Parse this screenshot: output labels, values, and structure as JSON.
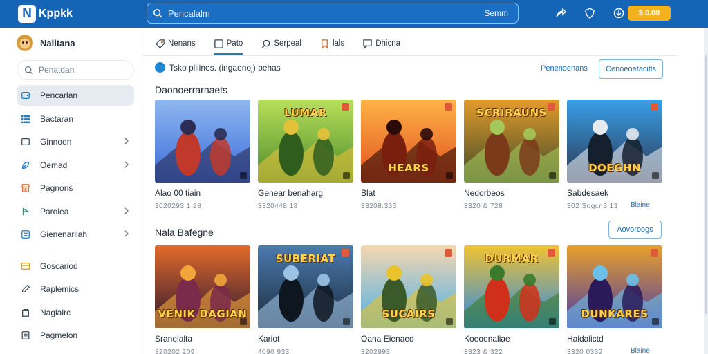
{
  "app": {
    "logo_letter": "N",
    "logo_text": "Kppkk"
  },
  "topbar": {
    "search_placeholder": "Pencalalm",
    "search_button": "Semm",
    "icons": [
      "share-icon",
      "shield-icon",
      "download-icon"
    ],
    "coins_label": "$ 0.00"
  },
  "sidebar": {
    "profile_name": "Nalltana",
    "search_placeholder": "Penatdan",
    "items": [
      {
        "label": "Pencarlan",
        "icon": "wallet-icon",
        "active": true,
        "chevron": false
      },
      {
        "label": "Bactaran",
        "icon": "list-icon",
        "active": false,
        "chevron": false
      },
      {
        "label": "Ginnoen",
        "icon": "square-icon",
        "active": false,
        "chevron": true
      },
      {
        "label": "Oemad",
        "icon": "leaf-icon",
        "active": false,
        "chevron": true
      },
      {
        "label": "Pagnons",
        "icon": "store-icon",
        "active": false,
        "chevron": false
      },
      {
        "label": "Parolea",
        "icon": "pin-icon",
        "active": false,
        "chevron": true
      },
      {
        "label": "Gienenarllah",
        "icon": "grid-icon",
        "active": false,
        "chevron": true
      },
      {
        "label": "Goscariod",
        "icon": "card-icon",
        "active": false,
        "chevron": false
      },
      {
        "label": "Raplemics",
        "icon": "pen-icon",
        "active": false,
        "chevron": false
      },
      {
        "label": "Naglalrc",
        "icon": "bag-icon",
        "active": false,
        "chevron": false
      },
      {
        "label": "Pagmelon",
        "icon": "document-icon",
        "active": false,
        "chevron": false
      }
    ]
  },
  "tabs": [
    {
      "label": "Nenans",
      "icon": "tag-icon",
      "active": false
    },
    {
      "label": "Pato",
      "icon": "page-icon",
      "active": true
    },
    {
      "label": "Serpeal",
      "icon": "search-icon",
      "active": false
    },
    {
      "label": "lals",
      "icon": "bookmark-icon",
      "active": false
    },
    {
      "label": "Dhicna",
      "icon": "chat-icon",
      "active": false
    }
  ],
  "notice": {
    "text": "Tsko plilines. (ingaenoj) behas"
  },
  "header_link": "Penenoenans",
  "header_button": "Cenoeoetacitls",
  "section1": {
    "title": "Daonoerrarnaets",
    "games": [
      {
        "title": "Alao 00 tiain",
        "sub": "3020293 1 28",
        "colors": [
          "#3b6bd9",
          "#8fb7f0",
          "#c0392b",
          "#2c2c54"
        ]
      },
      {
        "title": "Genear benaharg",
        "sub": "3320448 18",
        "colors": [
          "#4d8a2a",
          "#b8e05a",
          "#2f5d1e",
          "#e3c23a"
        ],
        "banner": "LUMAR"
      },
      {
        "title": "Blat",
        "sub": "33208.333",
        "colors": [
          "#e0501e",
          "#ffb347",
          "#7a1e0e",
          "#2a0a08"
        ],
        "banner": "HEARS"
      },
      {
        "title": "Nedorbeos",
        "sub": "3320 & 728",
        "colors": [
          "#3e4a2a",
          "#e39b2a",
          "#7b3b1a",
          "#a4c85a"
        ],
        "banner": "SCRIRAUNS"
      },
      {
        "title": "Sabdesaek",
        "sub": "302 Sogcn3 13",
        "colors": [
          "#2a3550",
          "#39a0e8",
          "#15202f",
          "#e5e9f0"
        ],
        "banner": "DOEGHN",
        "extra": "Blaine"
      }
    ]
  },
  "section2": {
    "title": "Nala Bafegne",
    "button": "Aovoroogs",
    "games": [
      {
        "title": "Sranelalta",
        "sub": "320202 209",
        "colors": [
          "#2a1830",
          "#e36a2a",
          "#7a2a4a",
          "#f2a53a"
        ],
        "banner": "VENIK DAGIAN"
      },
      {
        "title": "Kariot",
        "sub": "4090 933",
        "colors": [
          "#1c2a3a",
          "#4a7bb0",
          "#0e1620",
          "#9cc3e6"
        ],
        "banner": "SUBERIAT"
      },
      {
        "title": "Oana Eienaed",
        "sub": "3202993",
        "colors": [
          "#4ab0e8",
          "#f6d7b0",
          "#3a5a2a",
          "#e8c32a"
        ],
        "banner": "SUCAIRS"
      },
      {
        "title": "Koeoenaliae",
        "sub": "3323 & 322",
        "colors": [
          "#2a8ae8",
          "#f2c230",
          "#d0301a",
          "#3a7a2a"
        ],
        "banner": "DURMAR"
      },
      {
        "title": "Haldalictd",
        "sub": "3320 0332",
        "colors": [
          "#4a3aa8",
          "#e8a02a",
          "#2a1a5a",
          "#6ac0e8"
        ],
        "banner": "DUNKARES",
        "extra": "Blaine"
      }
    ]
  }
}
